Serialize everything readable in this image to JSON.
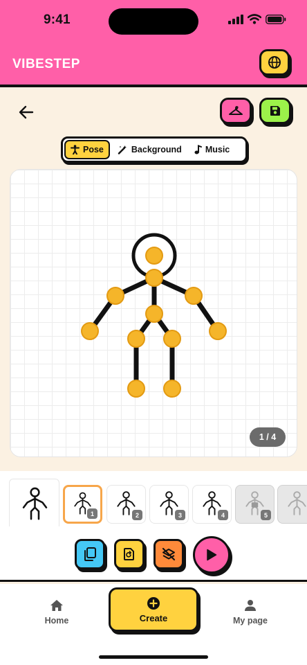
{
  "status_bar": {
    "time": "9:41",
    "icons": [
      "signal-icon",
      "wifi-icon",
      "battery-icon"
    ]
  },
  "header": {
    "brand": "VIBESTEP",
    "globe_icon": "globe-icon"
  },
  "toolbar": {
    "back_icon": "arrow-left-icon",
    "hanger_icon": "hanger-icon",
    "save_icon": "save-icon"
  },
  "tabs": [
    {
      "label": "Pose",
      "icon": "person-icon",
      "active": true
    },
    {
      "label": "Background",
      "icon": "magic-wand-icon",
      "active": false
    },
    {
      "label": "Music",
      "icon": "music-note-icon",
      "active": false
    }
  ],
  "canvas": {
    "page_indicator": "1 / 4"
  },
  "frames": [
    {
      "number": "",
      "state": "preview"
    },
    {
      "number": "1",
      "state": "selected"
    },
    {
      "number": "2",
      "state": "normal"
    },
    {
      "number": "3",
      "state": "normal"
    },
    {
      "number": "4",
      "state": "normal"
    },
    {
      "number": "5",
      "state": "locked"
    },
    {
      "number": "",
      "state": "locked"
    }
  ],
  "tools": [
    "copy-icon",
    "redo-icon",
    "clear-layers-icon",
    "play-icon"
  ],
  "bottom_nav": {
    "home": "Home",
    "create": "Create",
    "my_page": "My page"
  },
  "colors": {
    "header_pink": "#ff5fa8",
    "accent_yellow": "#ffd23f",
    "save_green": "#9cf24a",
    "copy_blue": "#45c8f5",
    "clear_orange": "#ff8a3a",
    "joint_orange": "#f5b52a",
    "background_cream": "#fbf1e2"
  }
}
